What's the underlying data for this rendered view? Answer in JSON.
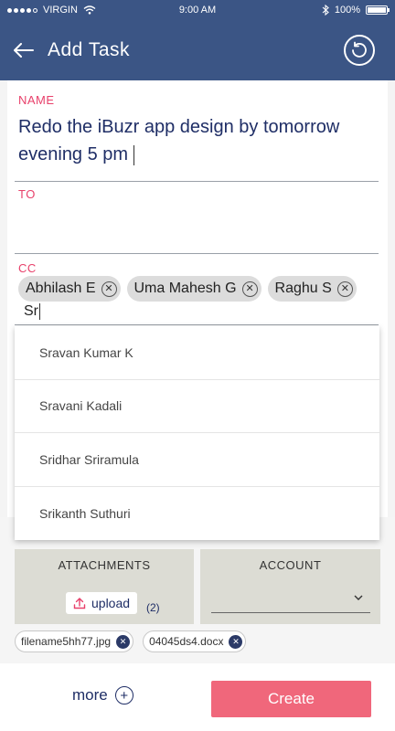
{
  "status_bar": {
    "carrier": "VIRGIN",
    "time": "9:00 AM",
    "battery": "100%",
    "battery_level": 1.0
  },
  "app_bar": {
    "title": "Add Task"
  },
  "form": {
    "name_label": "NAME",
    "name_value": "Redo the iBuzr app design by tomorrow evening 5 pm",
    "to_label": "TO",
    "to_value": "",
    "cc_label": "CC",
    "cc_chips": [
      "Abhilash E",
      "Uma Mahesh G",
      "Raghu S"
    ],
    "cc_input_value": "Sr"
  },
  "suggestions": [
    "Sravan Kumar K",
    "Sravani Kadali",
    "Sridhar Sriramula",
    "Srikanth Suthuri"
  ],
  "attachments": {
    "label": "ATTACHMENTS",
    "upload_label": "upload",
    "count": "(2)"
  },
  "account": {
    "label": "ACCOUNT",
    "value": ""
  },
  "files": [
    "filename5hh77.jpg",
    "04045ds4.docx"
  ],
  "footer": {
    "more_label": "more",
    "create_label": "Create"
  },
  "colors": {
    "header": "#3b5585",
    "accent": "#e8416b",
    "create": "#f0677b",
    "text": "#1f2e66"
  }
}
